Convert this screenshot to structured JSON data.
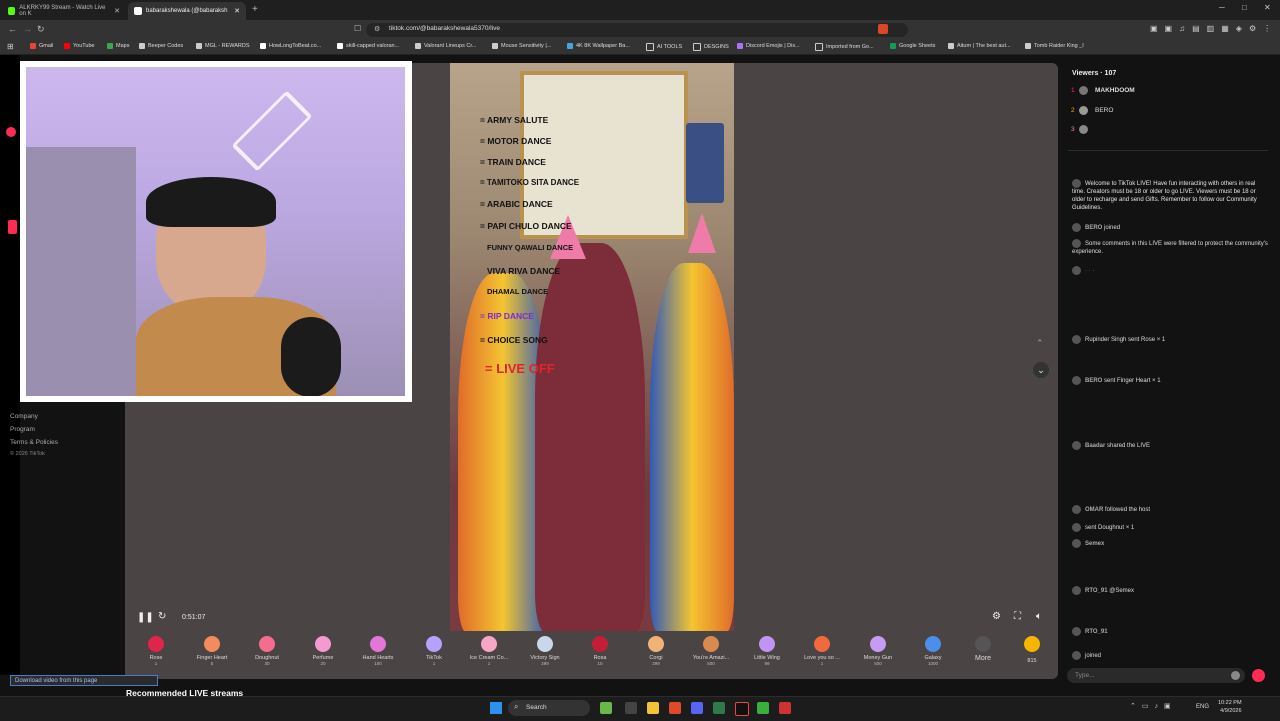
{
  "browser": {
    "tabs": [
      {
        "label": "ALKRKY99 Stream - Watch Live on K"
      },
      {
        "label": "babarakshewala (@babaraksh"
      }
    ],
    "url": "tiktok.com/@babarakshewala5370/live",
    "bookmarks": [
      "Gmail",
      "YouTube",
      "Maps",
      "Beeper Codes",
      "MGL - REWARDS",
      "HowLongToBeat.co...",
      "skill-capped valoran...",
      "Valorant Lineups Cr...",
      "Mouse Sensitivity |...",
      "4K 8K Wallpaper Ba...",
      "AI TOOLS",
      "DESGINS",
      "Discord Emojis | Dis...",
      "Imported from Go...",
      "Google Sheets",
      "Aitum | The best aut...",
      "Tomb Raider King _I"
    ]
  },
  "left_footer": [
    "Company",
    "Program",
    "Terms & Policies",
    "© 2026 TikTok"
  ],
  "video": {
    "menu": [
      "= ARMY SALUTE",
      "= MOTOR DANCE",
      "= TRAIN DANCE",
      "= TAMITOKO SITA DANCE",
      "= ARABIC DANCE",
      "= PAPI CHULO DANCE",
      "FUNNY QAWALI DANCE",
      "VIVA RIVA DANCE",
      "DHAMAL DANCE",
      "= RIP DANCE",
      "= CHOICE SONG",
      "= LIVE OFF"
    ],
    "elapsed": "0:51:07"
  },
  "gifts": [
    {
      "name": "Rose",
      "price": "1"
    },
    {
      "name": "Finger Heart",
      "price": "5"
    },
    {
      "name": "Doughnut",
      "price": "30"
    },
    {
      "name": "Perfume",
      "price": "20"
    },
    {
      "name": "Hand Hearts",
      "price": "100"
    },
    {
      "name": "TikTok",
      "price": "1"
    },
    {
      "name": "Ice Cream Co...",
      "price": "1"
    },
    {
      "name": "Victory Sign",
      "price": "299"
    },
    {
      "name": "Rosa",
      "price": "10"
    },
    {
      "name": "Corgi",
      "price": "299"
    },
    {
      "name": "You're Amazi...",
      "price": "500"
    },
    {
      "name": "Little Wing",
      "price": "99"
    },
    {
      "name": "Love you so ...",
      "price": "1"
    },
    {
      "name": "Money Gun",
      "price": "500"
    },
    {
      "name": "Galaxy",
      "price": "1000"
    }
  ],
  "gift_more": "More",
  "coin_balance": "815",
  "download_label": "Download video from this page",
  "recommended_label": "Recommended LIVE streams",
  "viewers": {
    "title": "Viewers · 107",
    "list": [
      {
        "name": "MAKHDOOM",
        "rank": "1"
      },
      {
        "name": "BERO",
        "rank": "2"
      },
      {
        "name": "",
        "rank": "3"
      }
    ]
  },
  "chat": [
    {
      "user": "",
      "text": "Welcome to TikTok LIVE! Have fun interacting with others in real time. Creators must be 18 or older to go LIVE. Viewers must be 18 or older to recharge and send Gifts. Remember to follow our Community Guidelines."
    },
    {
      "user": "BERO",
      "text": "joined"
    },
    {
      "user": "",
      "text": "Some comments in this LIVE were filtered to protect the community's experience."
    },
    {
      "user": "",
      "text": "Rupinder Singh sent Rose × 1"
    },
    {
      "user": "BERO",
      "text": "sent Finger Heart × 1"
    },
    {
      "user": "Baadar",
      "text": "shared the LIVE"
    },
    {
      "user": "OMAR",
      "text": "followed the host"
    },
    {
      "user": "",
      "text": "sent Doughnut × 1"
    },
    {
      "user": "Semex",
      "text": ""
    },
    {
      "user": "RTO_91",
      "text": "@Semex"
    },
    {
      "user": "RTO_91",
      "text": ""
    },
    {
      "user": "",
      "text": "joined"
    }
  ],
  "chat_placeholder": "Type...",
  "taskbar": {
    "search": "Search",
    "lang": "ENG",
    "time": "10:22 PM",
    "date": "4/9/2026"
  }
}
